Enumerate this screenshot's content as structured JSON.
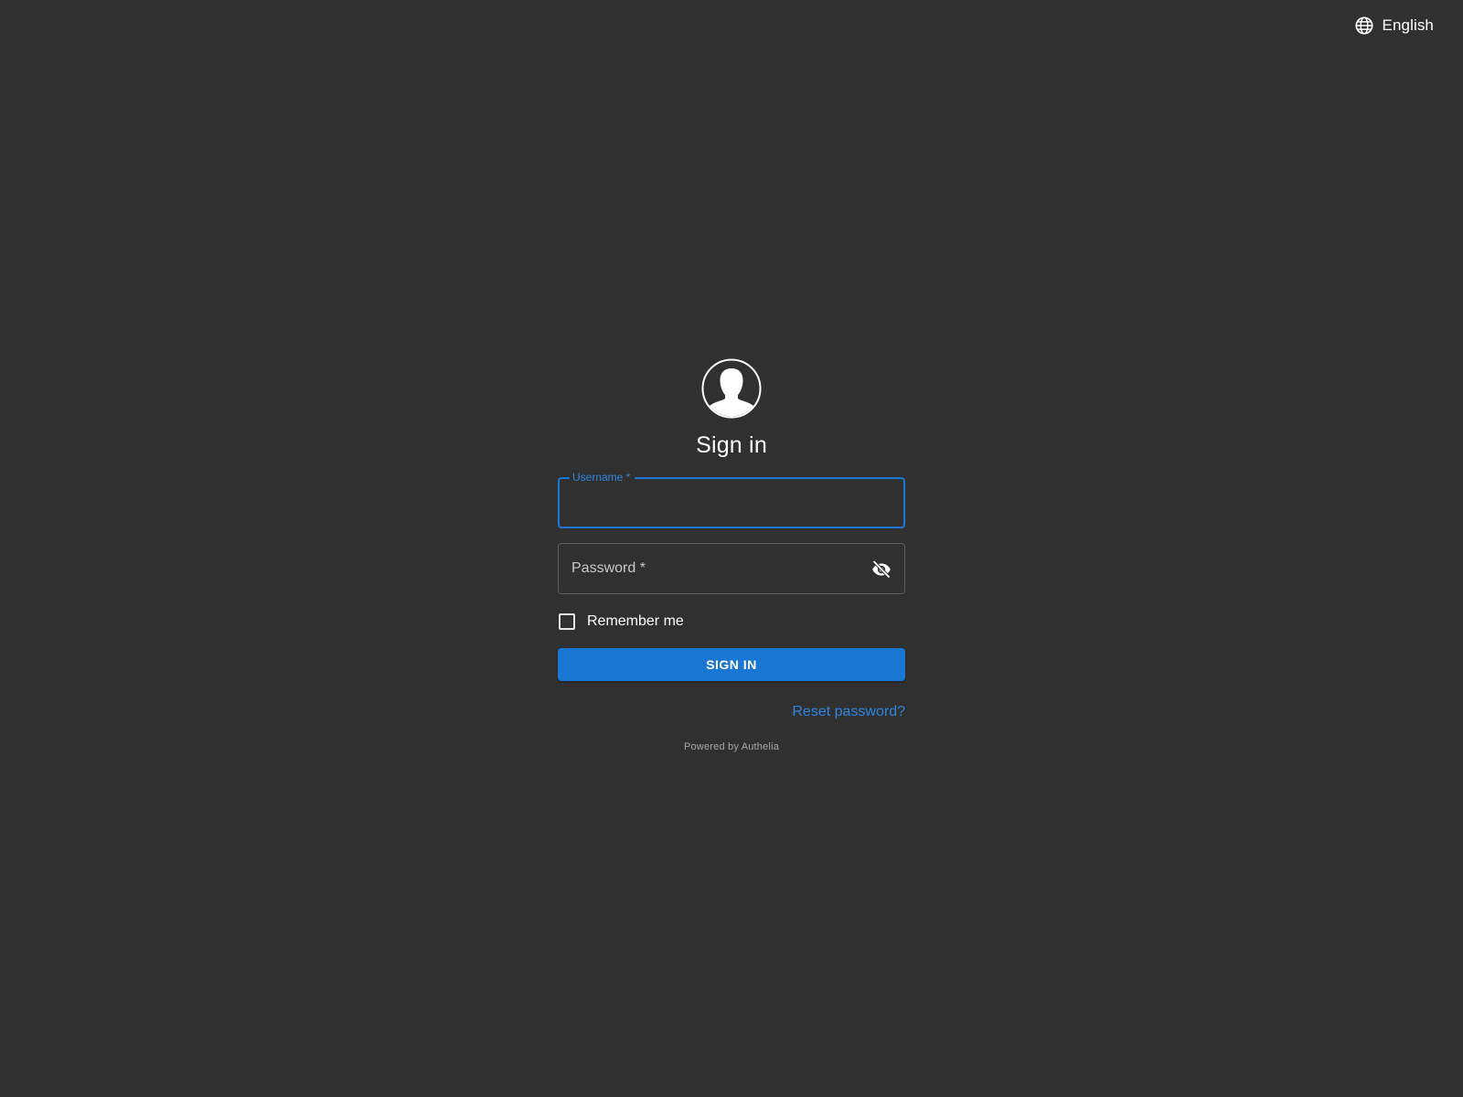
{
  "language": {
    "icon": "globe-icon",
    "label": "English"
  },
  "login": {
    "avatar_icon": "user-avatar-icon",
    "title": "Sign in",
    "username": {
      "label": "Username *",
      "value": ""
    },
    "password": {
      "label": "Password *",
      "value": "",
      "visibility_icon": "eye-off-icon"
    },
    "remember_me": {
      "label": "Remember me",
      "checked": false
    },
    "signin_button": "SIGN IN",
    "reset_link": "Reset password?",
    "powered_by": "Powered by Authelia"
  },
  "colors": {
    "background": "#303030",
    "accent": "#1976d2",
    "link": "#2e86de"
  }
}
